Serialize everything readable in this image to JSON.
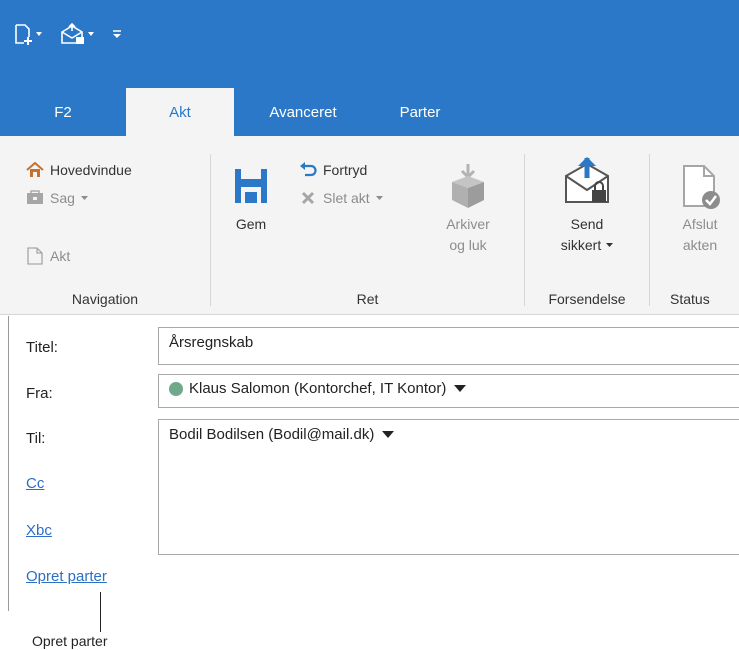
{
  "colors": {
    "accent": "#2b78c8",
    "ribbon": "#f4f4f4",
    "link": "#2b6fc4",
    "status_dot": "#6fa88a"
  },
  "quick_access": {
    "items": [
      "new-document-icon",
      "send-secure-icon",
      "customize-toolbar-icon"
    ]
  },
  "tabs": [
    {
      "label": "F2"
    },
    {
      "label": "Akt",
      "active": true
    },
    {
      "label": "Avanceret"
    },
    {
      "label": "Parter"
    }
  ],
  "ribbon": {
    "navigation": {
      "label": "Navigation",
      "hovedvindue": "Hovedvindue",
      "sag": "Sag",
      "akt": "Akt"
    },
    "ret": {
      "label": "Ret",
      "gem": "Gem",
      "fortryd": "Fortryd",
      "slet_akt": "Slet akt",
      "arkiver_1": "Arkiver",
      "arkiver_2": "og luk"
    },
    "forsendelse": {
      "label": "Forsendelse",
      "send_1": "Send",
      "send_2": "sikkert"
    },
    "status": {
      "label": "Status",
      "afslut_1": "Afslut",
      "afslut_2": "akten"
    }
  },
  "form": {
    "titel_label": "Titel:",
    "titel_value": "Årsregnskab",
    "fra_label": "Fra:",
    "fra_value": "Klaus Salomon (Kontorchef, IT Kontor)",
    "til_label": "Til:",
    "til_value": "Bodil Bodilsen (Bodil@mail.dk)",
    "cc_label": "Cc",
    "xbc_label": "Xbc",
    "opret_parter": "Opret parter"
  },
  "callout": {
    "text": "Opret parter"
  }
}
